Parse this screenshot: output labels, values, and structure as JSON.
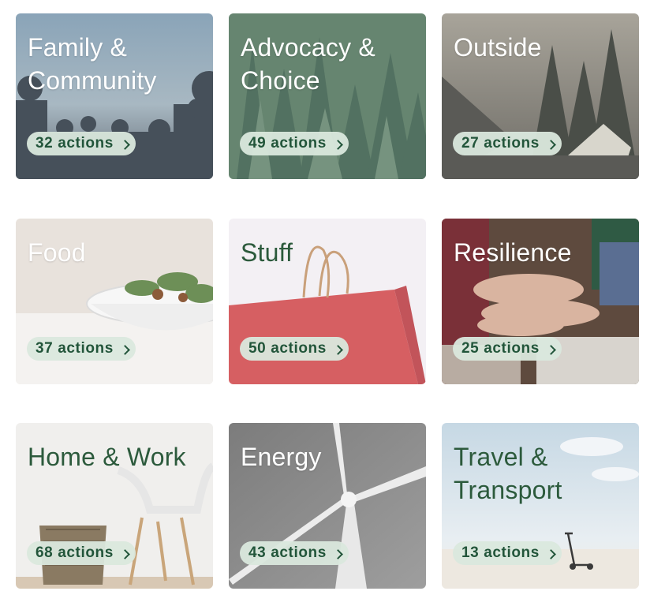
{
  "categories": [
    {
      "title": "Family & Community",
      "actions": "32 actions"
    },
    {
      "title": "Advocacy & Choice",
      "actions": "49 actions"
    },
    {
      "title": "Outside",
      "actions": "27 actions"
    },
    {
      "title": "Food",
      "actions": "37 actions"
    },
    {
      "title": "Stuff",
      "actions": "50 actions"
    },
    {
      "title": "Resilience",
      "actions": "25 actions"
    },
    {
      "title": "Home & Work",
      "actions": "68 actions"
    },
    {
      "title": "Energy",
      "actions": "43 actions"
    },
    {
      "title": "Travel & Transport",
      "actions": "13 actions"
    }
  ],
  "icons": {
    "pill_chevron": "chevron-right-icon"
  },
  "colors": {
    "title_dark": "#2c5a3c",
    "pill_bg": "#dae8dd",
    "pill_text": "#22553a"
  }
}
